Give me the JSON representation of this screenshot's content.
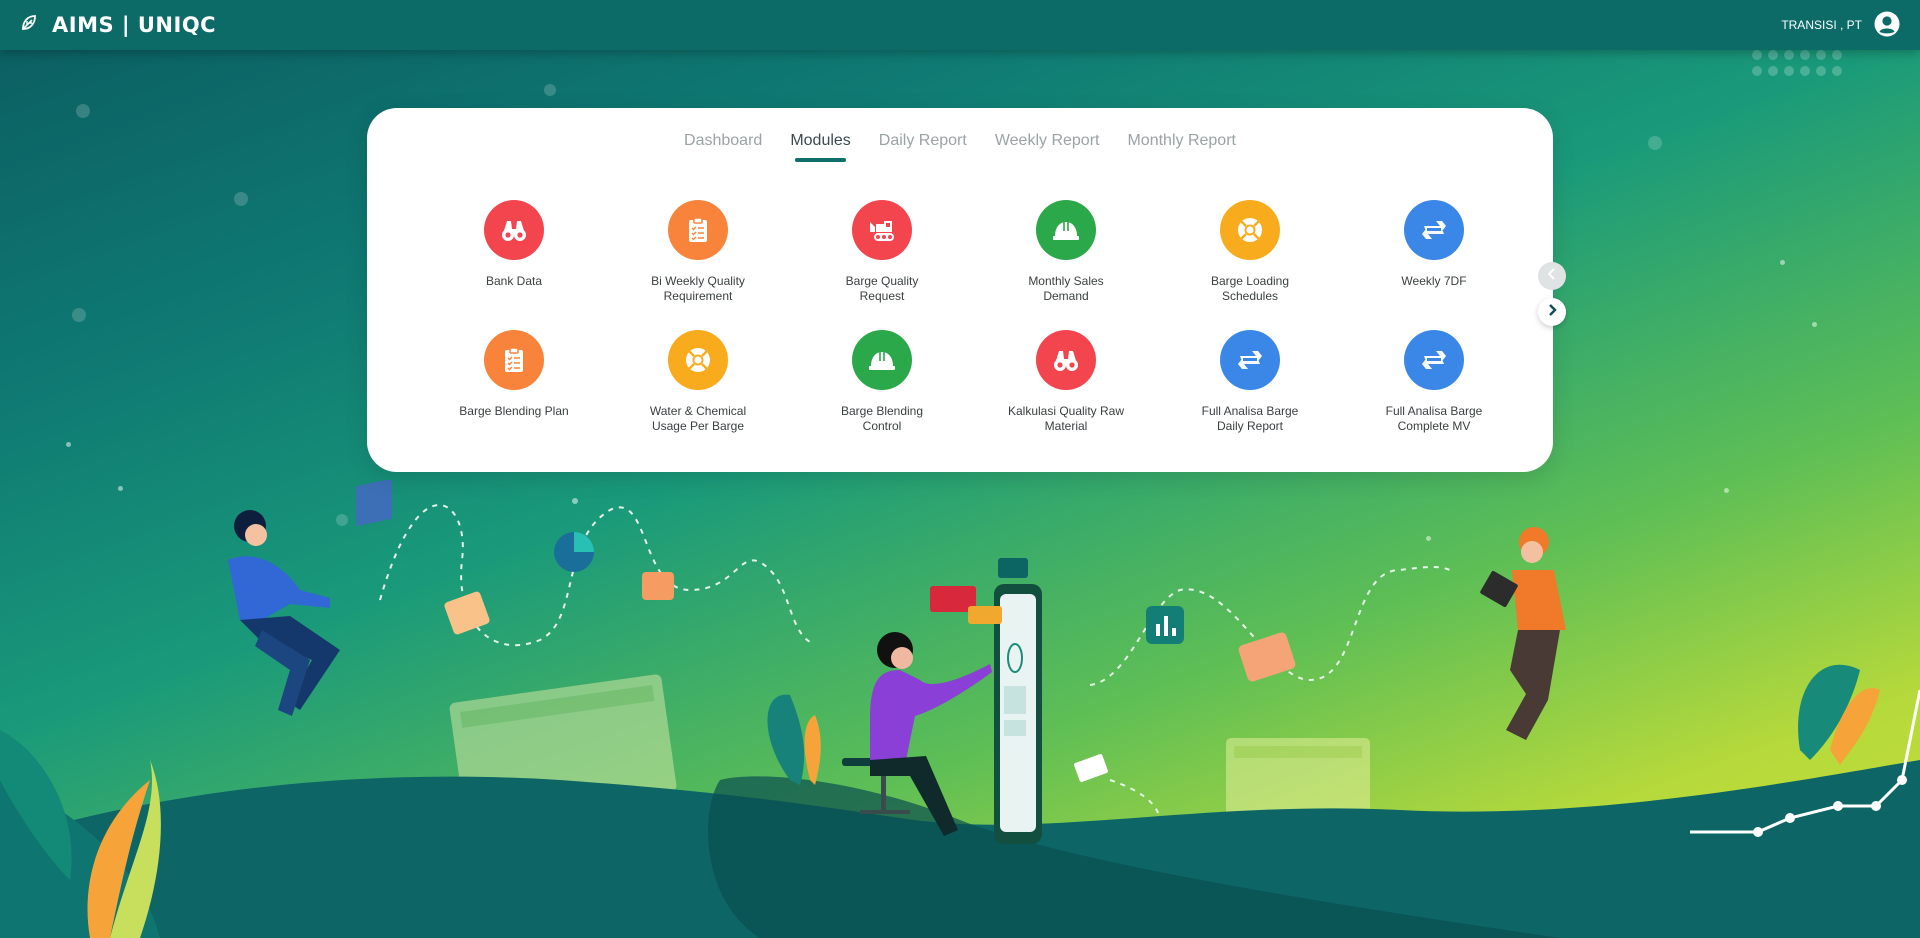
{
  "app": {
    "title": "AIMS | UNIQC"
  },
  "user": {
    "company": "TRANSISI , PT"
  },
  "tabs": [
    {
      "label": "Dashboard"
    },
    {
      "label": "Modules"
    },
    {
      "label": "Daily Report"
    },
    {
      "label": "Weekly Report"
    },
    {
      "label": "Monthly Report"
    }
  ],
  "active_tab": "Modules",
  "modules": [
    {
      "label": "Bank Data",
      "icon": "binoculars-icon",
      "color": "#f2454e"
    },
    {
      "label": "Bi Weekly Quality Requirement",
      "icon": "clipboard-icon",
      "color": "#f7843a"
    },
    {
      "label": "Barge Quality Request",
      "icon": "bulldozer-icon",
      "color": "#f2454e"
    },
    {
      "label": "Monthly Sales Demand",
      "icon": "helmet-icon",
      "color": "#2aa84a"
    },
    {
      "label": "Barge Loading Schedules",
      "icon": "lifebuoy-icon",
      "color": "#f9ab1e"
    },
    {
      "label": "Weekly 7DF",
      "icon": "exchange-icon",
      "color": "#3b87e8"
    },
    {
      "label": "Barge Blending Plan",
      "icon": "clipboard-icon",
      "color": "#f7843a"
    },
    {
      "label": "Water & Chemical Usage Per Barge",
      "icon": "lifebuoy-icon",
      "color": "#f9ab1e"
    },
    {
      "label": "Barge Blending Control",
      "icon": "helmet-icon",
      "color": "#2aa84a"
    },
    {
      "label": "Kalkulasi Quality Raw Material",
      "icon": "binoculars-icon",
      "color": "#f2454e"
    },
    {
      "label": "Full Analisa Barge Daily Report",
      "icon": "exchange-icon",
      "color": "#3b87e8"
    },
    {
      "label": "Full Analisa Barge Complete MV",
      "icon": "exchange-icon",
      "color": "#3b87e8"
    }
  ],
  "colors": {
    "topbar": "#0c6a67",
    "tab_underline": "#0f6f6b"
  }
}
